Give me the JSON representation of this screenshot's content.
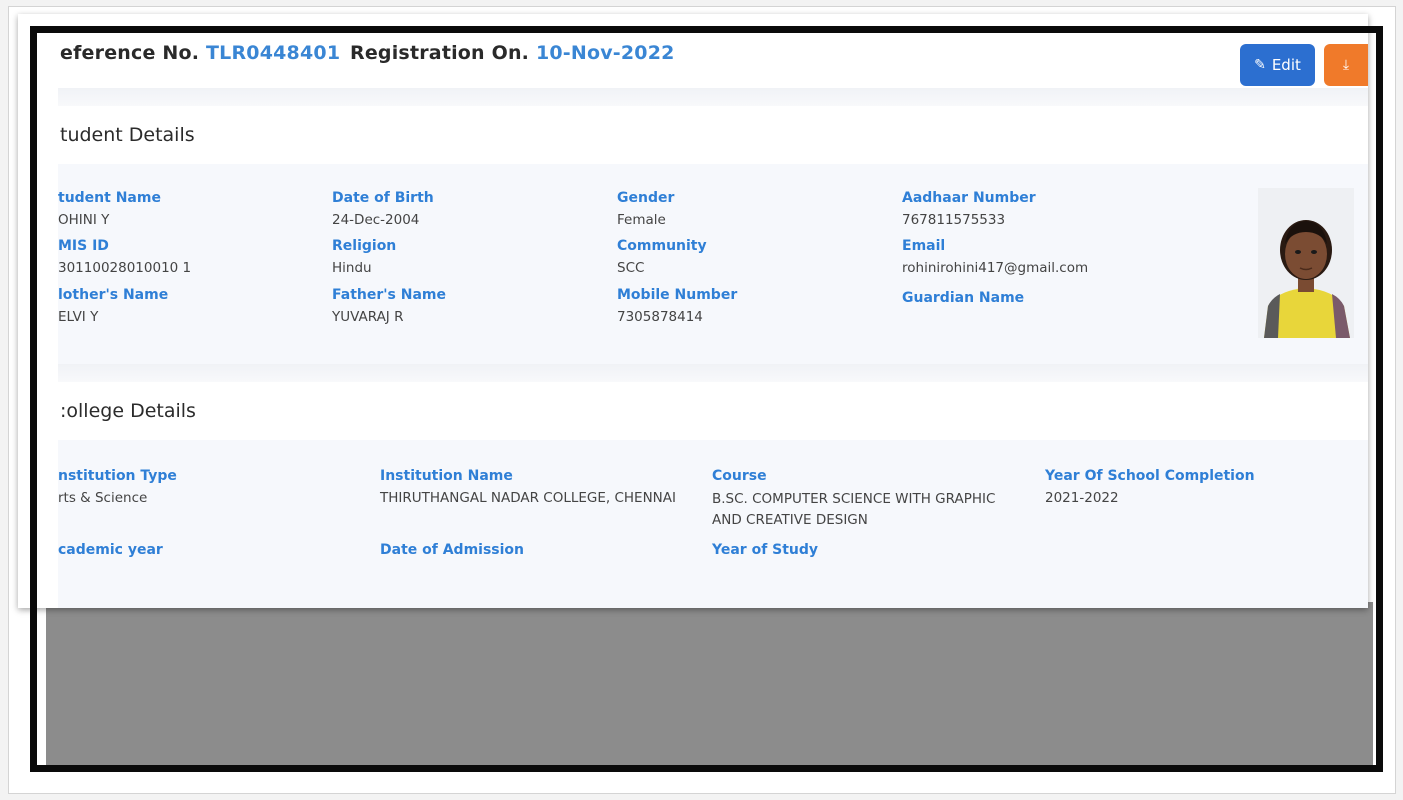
{
  "header": {
    "reference_label": "eference No.",
    "reference_value": "TLR0448401",
    "registration_label": "Registration On.",
    "registration_value": "10-Nov-2022",
    "edit_label": "Edit"
  },
  "student_details": {
    "title": "tudent Details",
    "fields": [
      {
        "label": "tudent Name",
        "value": "OHINI Y"
      },
      {
        "label": "Date of Birth",
        "value": "24-Dec-2004"
      },
      {
        "label": "Gender",
        "value": "Female"
      },
      {
        "label": "Aadhaar Number",
        "value": "767811575533"
      },
      {
        "label": "MIS ID",
        "value": "30110028010010 1"
      },
      {
        "label": "Religion",
        "value": "Hindu"
      },
      {
        "label": "Community",
        "value": "SCC"
      },
      {
        "label": "Email",
        "value": "rohinirohini417@gmail.com"
      },
      {
        "label": "lother's Name",
        "value": "ELVI Y"
      },
      {
        "label": "Father's Name",
        "value": "YUVARAJ R"
      },
      {
        "label": "Mobile Number",
        "value": "7305878414"
      },
      {
        "label": "Guardian Name",
        "value": ""
      }
    ]
  },
  "college_details": {
    "title": ":ollege Details",
    "fields": [
      {
        "label": "nstitution Type",
        "value": "rts & Science"
      },
      {
        "label": "Institution Name",
        "value": "THIRUTHANGAL NADAR COLLEGE, CHENNAI"
      },
      {
        "label": "Course",
        "value": "B.SC. COMPUTER SCIENCE WITH GRAPHIC AND CREATIVE DESIGN"
      },
      {
        "label": "Year Of School Completion",
        "value": "2021-2022"
      },
      {
        "label": "cademic year",
        "value": ""
      },
      {
        "label": "Date of Admission",
        "value": ""
      },
      {
        "label": "Year of Study",
        "value": ""
      }
    ]
  },
  "icons": {
    "edit": "pencil-icon",
    "pdf": "pdf-icon"
  },
  "colors": {
    "label_blue": "#2f7fd6",
    "edit_button": "#2c6fd0",
    "pdf_button": "#f07a2a"
  }
}
